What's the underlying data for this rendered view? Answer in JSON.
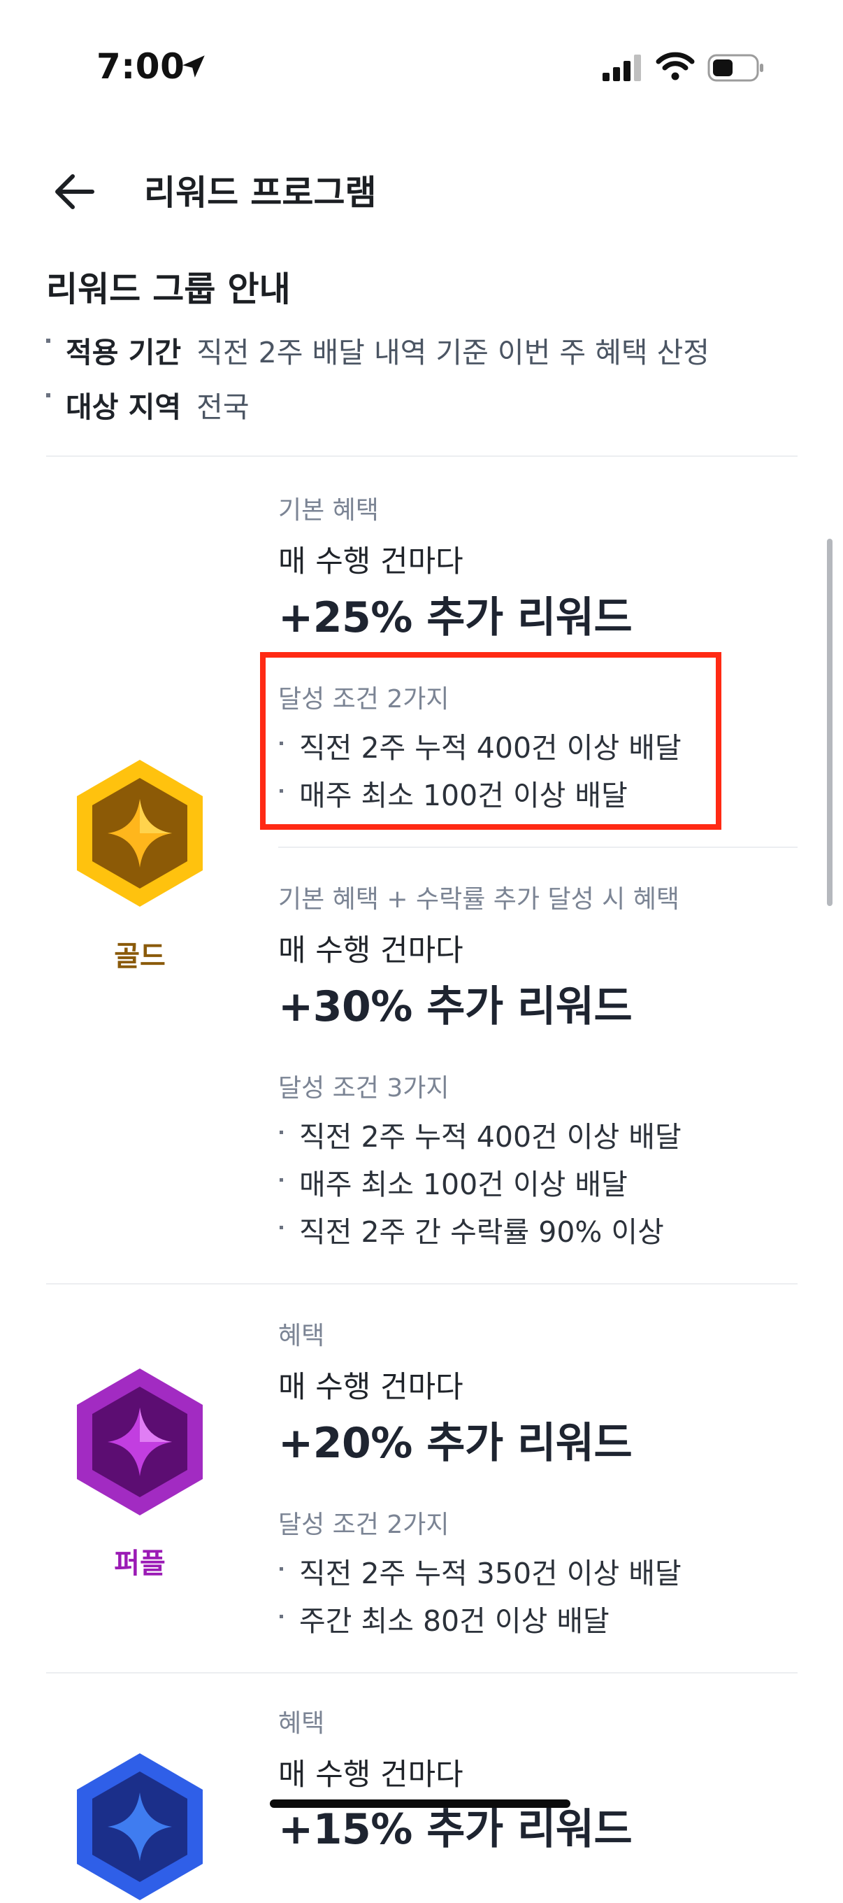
{
  "status_bar": {
    "time": "7:00"
  },
  "nav": {
    "title": "리워드 프로그램"
  },
  "intro": {
    "title": "리워드 그룹 안내",
    "rows": [
      {
        "label": "적용 기간",
        "value": "직전 2주 배달 내역 기준 이번 주 혜택 산정"
      },
      {
        "label": "대상 지역",
        "value": "전국"
      }
    ]
  },
  "tiers": [
    {
      "name": "골드",
      "color": "#8a5a0a",
      "benefit_label": "기본 혜택",
      "per_task": "매 수행 건마다",
      "reward": "+25% 추가 리워드",
      "condition_title": "달성 조건 2가지",
      "conditions": [
        "직전 2주 누적 400건 이상 배달",
        "매주 최소 100건 이상 배달"
      ],
      "bonus": {
        "benefit_label": "기본 혜택 + 수락률 추가 달성 시 혜택",
        "per_task": "매 수행 건마다",
        "reward": "+30% 추가 리워드",
        "condition_title": "달성 조건 3가지",
        "conditions": [
          "직전 2주 누적 400건 이상 배달",
          "매주 최소 100건 이상 배달",
          "직전 2주 간 수락률 90% 이상"
        ]
      }
    },
    {
      "name": "퍼플",
      "color": "#9b1bb5",
      "benefit_label": "혜택",
      "per_task": "매 수행 건마다",
      "reward": "+20% 추가 리워드",
      "condition_title": "달성 조건 2가지",
      "conditions": [
        "직전 2주 누적 350건 이상 배달",
        "주간 최소 80건 이상 배달"
      ]
    },
    {
      "name": "",
      "color": "#2f5fe8",
      "benefit_label": "혜택",
      "per_task": "매 수행 건마다",
      "reward": "+15% 추가 리워드"
    }
  ]
}
